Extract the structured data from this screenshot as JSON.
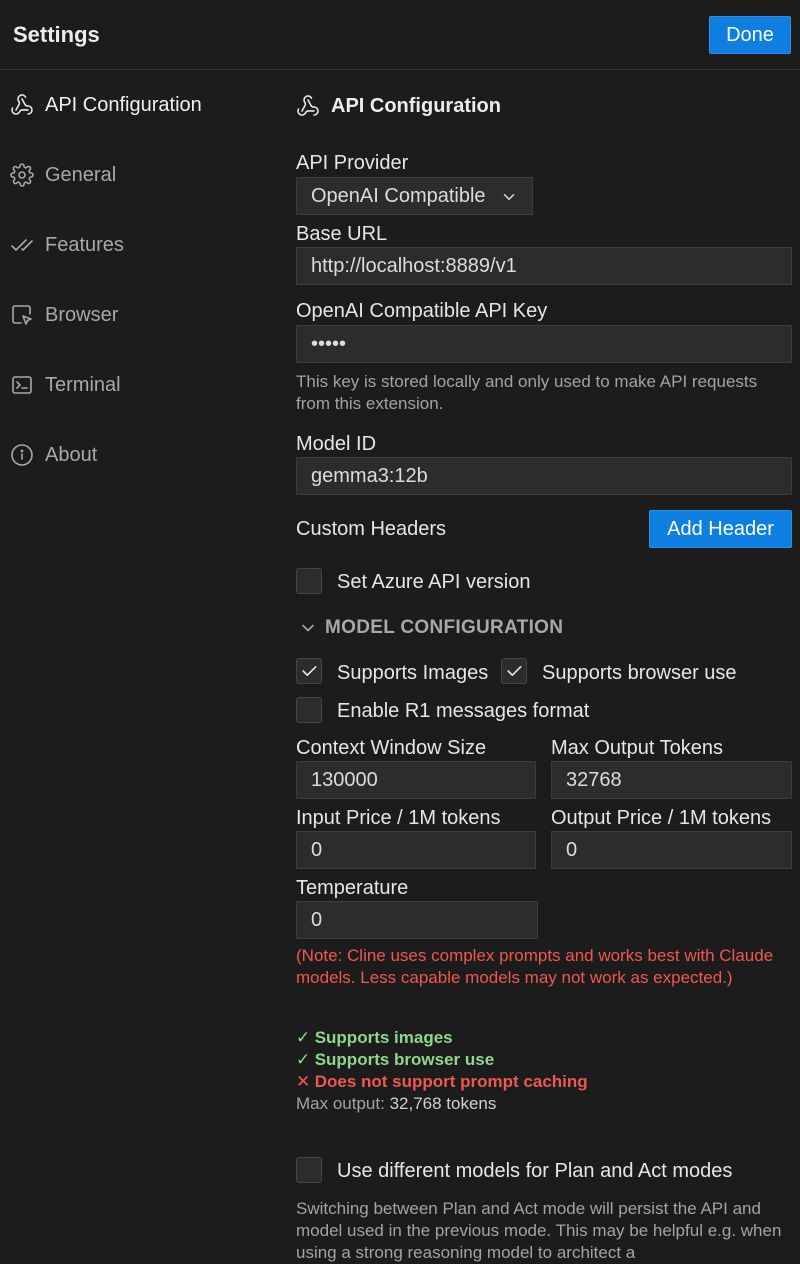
{
  "header": {
    "title": "Settings",
    "done_label": "Done"
  },
  "sidebar": {
    "items": [
      {
        "label": "API Configuration",
        "icon": "webhook-icon"
      },
      {
        "label": "General",
        "icon": "gear-icon"
      },
      {
        "label": "Features",
        "icon": "checks-icon"
      },
      {
        "label": "Browser",
        "icon": "browser-pointer-icon"
      },
      {
        "label": "Terminal",
        "icon": "terminal-icon"
      },
      {
        "label": "About",
        "icon": "info-icon"
      }
    ],
    "active_index": 0
  },
  "main": {
    "section_title": "API Configuration",
    "api_provider": {
      "label": "API Provider",
      "value": "OpenAI Compatible"
    },
    "base_url": {
      "label": "Base URL",
      "value": "http://localhost:8889/v1"
    },
    "api_key": {
      "label": "OpenAI Compatible API Key",
      "value": "•••••",
      "hint": "This key is stored locally and only used to make API requests from this extension."
    },
    "model_id": {
      "label": "Model ID",
      "value": "gemma3:12b"
    },
    "custom_headers": {
      "label": "Custom Headers",
      "button": "Add Header"
    },
    "azure": {
      "label": "Set Azure API version",
      "checked": false
    },
    "model_config": {
      "title": "MODEL CONFIGURATION",
      "supports_images": {
        "label": "Supports Images",
        "checked": true
      },
      "supports_browser": {
        "label": "Supports browser use",
        "checked": true
      },
      "r1_format": {
        "label": "Enable R1 messages format",
        "checked": false
      },
      "context_window": {
        "label": "Context Window Size",
        "value": "130000"
      },
      "max_output": {
        "label": "Max Output Tokens",
        "value": "32768"
      },
      "input_price": {
        "label": "Input Price / 1M tokens",
        "value": "0"
      },
      "output_price": {
        "label": "Output Price / 1M tokens",
        "value": "0"
      },
      "temperature": {
        "label": "Temperature",
        "value": "0"
      }
    },
    "note": "(Note: Cline uses complex prompts and works best with Claude models. Less capable models may not work as expected.)",
    "capabilities": {
      "images": "Supports images",
      "browser": "Supports browser use",
      "caching": "Does not support prompt caching",
      "max_output_label": "Max output:",
      "max_output_value": "32,768 tokens"
    },
    "plan_act": {
      "label": "Use different models for Plan and Act modes",
      "checked": false,
      "hint": "Switching between Plan and Act mode will persist the API and model used in the previous mode. This may be helpful e.g. when using a strong reasoning model to architect a"
    }
  },
  "colors": {
    "accent": "#0e7fe0",
    "success": "#8dd88e",
    "error": "#f0574f",
    "background": "#1c1c1c"
  }
}
